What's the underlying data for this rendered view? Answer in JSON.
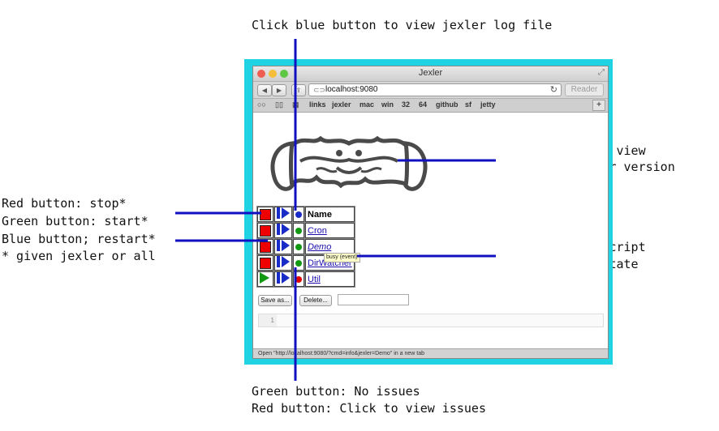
{
  "annotations": {
    "top": "Click blue button to view jexler log file",
    "right1": [
      "Click to reload view",
      "Hover for jexler version"
    ],
    "left": [
      "Red button: stop*",
      "Green button: start*",
      "Blue button; restart*",
      "* given jexler or all"
    ],
    "right2": [
      "Click to edit script",
      "Hover for run state"
    ],
    "bottom": [
      "Green button: No issues",
      "Red button: Click to view issues"
    ]
  },
  "window": {
    "title": "Jexler",
    "url": "localhost:9080",
    "reader_label": "Reader",
    "bookmarks": [
      "links",
      "jexler",
      "mac",
      "win",
      "32",
      "64",
      "github",
      "sf",
      "jetty"
    ],
    "status_text": "Open \"http://localhost:9080/?cmd=info&jexler=Demo\" in a new tab"
  },
  "table": {
    "header": "Name",
    "rows": [
      {
        "name": "Cron",
        "state": "running",
        "status": "green"
      },
      {
        "name": "Demo",
        "state": "running",
        "status": "green"
      },
      {
        "name": "DirWatcher",
        "state": "running",
        "status": "green"
      },
      {
        "name": "Util",
        "state": "stopped",
        "status": "red"
      }
    ],
    "tooltip": "busy (event)"
  },
  "controls": {
    "save_label": "Save as...",
    "delete_label": "Delete...",
    "editor_line": "1"
  },
  "colors": {
    "accent": "#1010c0",
    "red": "#e00000",
    "green": "#119911",
    "blue": "#1a2cc8",
    "frame": "#1fd3e3"
  }
}
